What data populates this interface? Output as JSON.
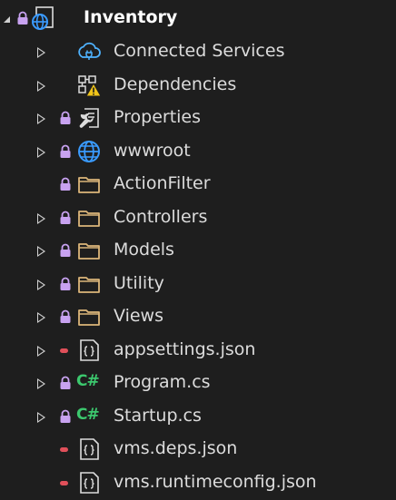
{
  "tree": {
    "root": {
      "label": "Inventory",
      "icon": "web-project-icon",
      "state": "expanded",
      "locked": true
    },
    "items": [
      {
        "label": "Connected Services",
        "icon": "connected-services-icon",
        "state": "collapsed",
        "badge": "none"
      },
      {
        "label": "Dependencies",
        "icon": "dependencies-warning-icon",
        "state": "collapsed",
        "badge": "none"
      },
      {
        "label": "Properties",
        "icon": "properties-icon",
        "state": "collapsed",
        "badge": "lock"
      },
      {
        "label": "wwwroot",
        "icon": "globe-icon",
        "state": "collapsed",
        "badge": "lock"
      },
      {
        "label": "ActionFilter",
        "icon": "folder-icon",
        "state": "none",
        "badge": "lock"
      },
      {
        "label": "Controllers",
        "icon": "folder-icon",
        "state": "collapsed",
        "badge": "lock"
      },
      {
        "label": "Models",
        "icon": "folder-icon",
        "state": "collapsed",
        "badge": "lock"
      },
      {
        "label": "Utility",
        "icon": "folder-icon",
        "state": "collapsed",
        "badge": "lock"
      },
      {
        "label": "Views",
        "icon": "folder-icon",
        "state": "collapsed",
        "badge": "lock"
      },
      {
        "label": "appsettings.json",
        "icon": "json-file-icon",
        "state": "collapsed",
        "badge": "red"
      },
      {
        "label": "Program.cs",
        "icon": "csharp-file-icon",
        "state": "collapsed",
        "badge": "lock",
        "icon_text": "C#"
      },
      {
        "label": "Startup.cs",
        "icon": "csharp-file-icon",
        "state": "collapsed",
        "badge": "lock",
        "icon_text": "C#"
      },
      {
        "label": "vms.deps.json",
        "icon": "json-file-icon",
        "state": "none",
        "badge": "red"
      },
      {
        "label": "vms.runtimeconfig.json",
        "icon": "json-file-icon",
        "state": "none",
        "badge": "red"
      }
    ]
  },
  "colors": {
    "background": "#1e1e1e",
    "text": "#dcdcdc",
    "lock": "#c8a2f0",
    "red_badge": "#e0505a",
    "folder": "#dcb67a",
    "csharp": "#3cc86e",
    "globe": "#3a9bff"
  }
}
